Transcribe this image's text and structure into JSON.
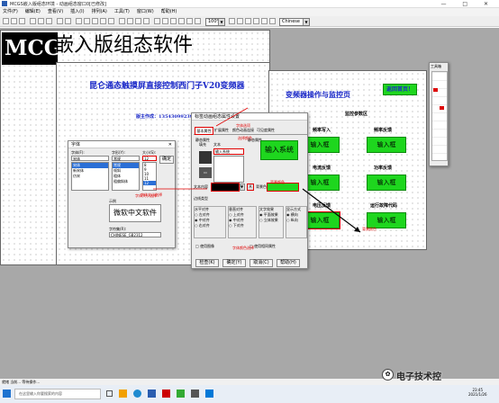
{
  "window": {
    "title": "MCGS嵌入版组态环境 - 动画组态窗口0[已修改]",
    "controls": "—  □  ✕"
  },
  "menu": [
    "文件(F)",
    "编辑(E)",
    "查看(V)",
    "插入(I)",
    "排列(A)",
    "工具(T)",
    "窗口(W)",
    "帮助(H)"
  ],
  "toolbar": {
    "zoom": "100%",
    "font": "Chinese"
  },
  "banner": {
    "left": "MCGS",
    "right": "嵌入版组态软件"
  },
  "window1": {
    "title": "昆仑通态触摸屏直接控制西门子V20变频器",
    "author": "版主作成：13543099239"
  },
  "window2": {
    "title": "变频器操作与监控页",
    "return_btn": "返回首页！",
    "subtitle": "监控参数区",
    "labels": [
      "频率写入",
      "频率反馈",
      "电流反馈",
      "功率反馈",
      "电压反馈",
      "运行故障代码"
    ],
    "input_btn": "输入框"
  },
  "prop_dialog": {
    "title": "标签动画组态属性设置",
    "tabs": [
      "基本属性",
      "扩展属性",
      "颜色动画连接",
      "可见度属性"
    ],
    "static_label": "静态属性",
    "fill_color": "填充颜色",
    "border_color": "边线颜色",
    "fill_text": "填充",
    "text_label": "文本",
    "text_value": "输入系统",
    "sample": "输入系统",
    "char_color": "字符颜色",
    "font_label": "文本内容",
    "bg_label": "背景色",
    "border_type": "边线类型",
    "halign": "水平对齐",
    "valign": "垂直对齐",
    "effect": "文字效果",
    "show": "显示方式",
    "h_opts": [
      "左对齐",
      "中对齐",
      "右对齐"
    ],
    "v_opts": [
      "上对齐",
      "中对齐",
      "下对齐"
    ],
    "e_opts": [
      "平面效果",
      "立体效果"
    ],
    "s_opts": [
      "横向",
      "纵向"
    ],
    "check1": "使用图像",
    "check2": "使用相同属性",
    "buttons": [
      "检查(K)",
      "确定(Y)",
      "取消(C)",
      "帮助(H)"
    ]
  },
  "font_dialog": {
    "title": "字体",
    "font_label": "字体(F):",
    "style_label": "字形(Y):",
    "size_label": "大小(S):",
    "font_value": "宋体",
    "fonts": [
      "宋体",
      "新宋体",
      "仿宋"
    ],
    "style_value": "常规",
    "styles": [
      "常规",
      "倾斜",
      "粗体",
      "粗偏斜体"
    ],
    "size_value": "12",
    "sizes": [
      "8",
      "9",
      "10",
      "11",
      "12",
      "14",
      "16"
    ],
    "ok": "确定",
    "preview_label": "示例",
    "preview_text": "微软中文软件",
    "script_label": "字符集(R):",
    "script_value": "CHINESE_GB2312"
  },
  "annotations": {
    "a1": "字体选项",
    "a2": "选择颜色",
    "a3": "字体大小选择",
    "a4": "字体颜色选择",
    "a5": "背景颜色"
  },
  "status": "就绪 当前... 等待操作...",
  "taskbar": {
    "search": "在这里输入你要搜索的内容",
    "time": "23:45",
    "date": "2021/1/26"
  },
  "watermark": "电子技术控",
  "toolbox": {
    "title": "工具箱"
  }
}
